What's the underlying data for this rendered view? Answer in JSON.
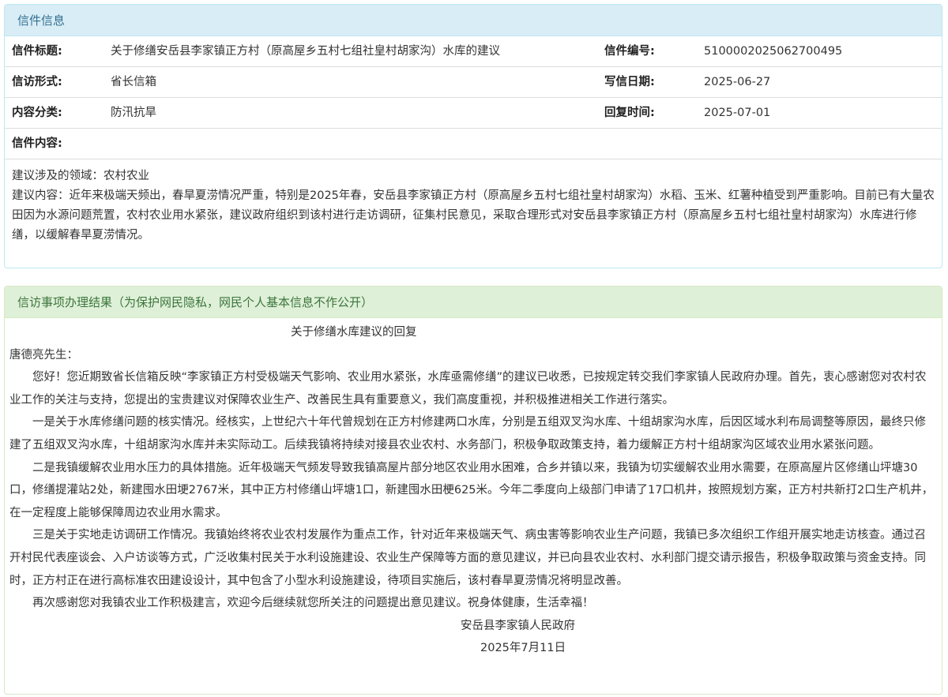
{
  "info": {
    "heading": "信件信息",
    "rows": [
      {
        "label1": "信件标题:",
        "value1": "关于修缮安岳县李家镇正方村（原高屋乡五村七组社皇村胡家沟）水库的建议",
        "label2": "信件编号:",
        "value2": "5100002025062700495"
      },
      {
        "label1": "信访形式:",
        "value1": "省长信箱",
        "label2": "写信日期:",
        "value2": "2025-06-27"
      },
      {
        "label1": "内容分类:",
        "value1": "防汛抗旱",
        "label2": "回复时间:",
        "value2": "2025-07-01"
      }
    ],
    "content_label": "信件内容:",
    "content": [
      "建议涉及的领域：农村农业",
      "建议内容：近年来极端天频出，春旱夏涝情况严重，特别是2025年春，安岳县李家镇正方村（原高屋乡五村七组社皇村胡家沟）水稻、玉米、红薯种植受到严重影响。目前已有大量农田因为水源问题荒置，农村农业用水紧张，建议政府组织到该村进行走访调研，征集村民意见，采取合理形式对安岳县李家镇正方村（原高屋乡五村七组社皇村胡家沟）水库进行修缮，以缓解春旱夏涝情况。"
    ]
  },
  "result": {
    "heading": "信访事项办理结果（为保护网民隐私，网民个人基本信息不作公开）",
    "title": "关于修缮水库建议的回复",
    "salutation": "唐德亮先生：",
    "paragraphs": [
      "您好！您近期致省长信箱反映“李家镇正方村受极端天气影响、农业用水紧张，水库亟需修缮”的建议已收悉，已按规定转交我们李家镇人民政府办理。首先，衷心感谢您对农村农业工作的关注与支持，您提出的宝贵建议对保障农业生产、改善民生具有重要意义，我们高度重视，并积极推进相关工作进行落实。",
      "一是关于水库修缮问题的核实情况。经核实，上世纪六十年代曾规划在正方村修建两口水库，分别是五组双叉沟水库、十组胡家沟水库，后因区域水利布局调整等原因，最终只修建了五组双叉沟水库，十组胡家沟水库并未实际动工。后续我镇将持续对接县农业农村、水务部门，积极争取政策支持，着力缓解正方村十组胡家沟区域农业用水紧张问题。",
      "二是我镇缓解农业用水压力的具体措施。近年极端天气频发导致我镇高屋片部分地区农业用水困难，合乡并镇以来，我镇为切实缓解农业用水需要，在原高屋片区修缮山坪塘30口，修缮提灌站2处，新建囤水田埂2767米，其中正方村修缮山坪塘1口，新建囤水田梗625米。今年二季度向上级部门申请了17口机井，按照规划方案，正方村共新打2口生产机井，在一定程度上能够保障周边农业用水需求。",
      "三是关于实地走访调研工作情况。我镇始终将农业农村发展作为重点工作，针对近年来极端天气、病虫害等影响农业生产问题，我镇已多次组织工作组开展实地走访核查。通过召开村民代表座谈会、入户访谈等方式，广泛收集村民关于水利设施建设、农业生产保障等方面的意见建议，并已向县农业农村、水利部门提交请示报告，积极争取政策与资金支持。同时，正方村正在进行高标准农田建设设计，其中包含了小型水利设施建设，待项目实施后，该村春旱夏涝情况将明显改善。",
      "再次感谢您对我镇农业工作积极建言，欢迎今后继续就您所关注的问题提出意见建议。祝身体健康，生活幸福！"
    ],
    "signature": "安岳县李家镇人民政府",
    "date": "2025年7月11日"
  },
  "colors": {
    "info_heading_bg": "#d9edf7",
    "info_heading_text": "#31708f",
    "success_heading_bg": "#dff0d8",
    "success_heading_text": "#3c763d"
  }
}
